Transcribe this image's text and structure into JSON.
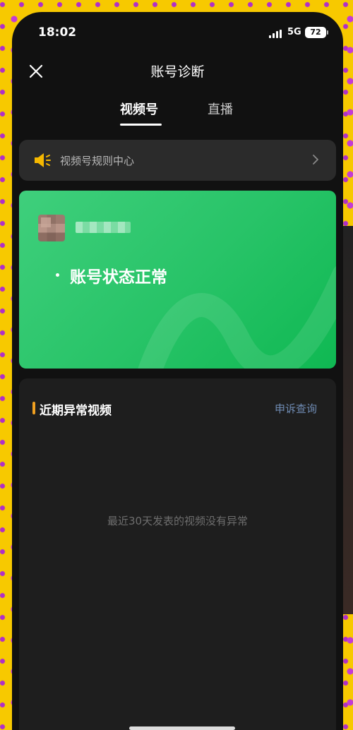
{
  "status_bar": {
    "time": "18:02",
    "network": "5G",
    "battery": "72"
  },
  "header": {
    "title": "账号诊断"
  },
  "tabs": [
    {
      "label": "视频号",
      "active": true
    },
    {
      "label": "直播",
      "active": false
    }
  ],
  "notice": {
    "icon": "megaphone-icon",
    "text": "视频号规则中心"
  },
  "status_card": {
    "status": "账号状态正常"
  },
  "abnormal_videos": {
    "title": "近期异常视频",
    "appeal_link": "申诉查询",
    "empty_message": "最近30天发表的视频没有异常"
  },
  "colors": {
    "card_green": "#27c367",
    "accent_orange": "#f0a020",
    "link_blue": "#6f8bb3",
    "notice_icon": "#f5b800"
  }
}
